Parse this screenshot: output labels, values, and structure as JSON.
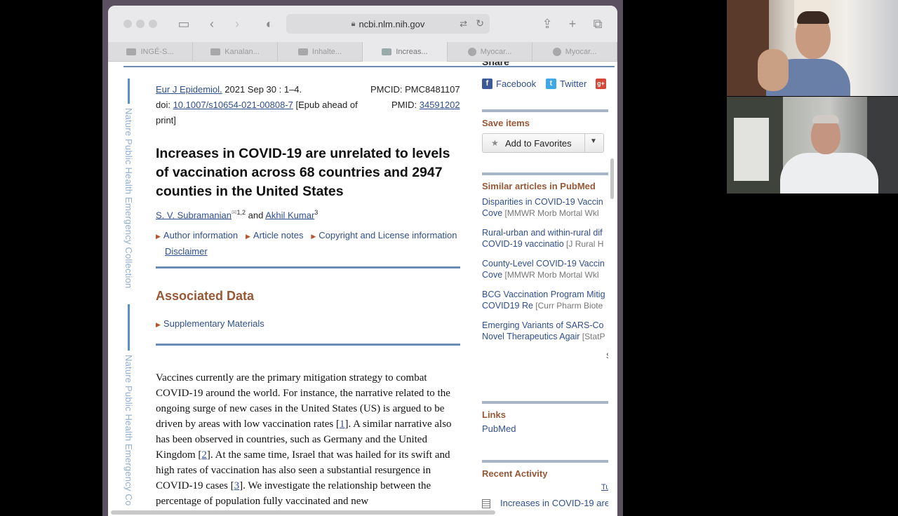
{
  "browser": {
    "url": "ncbi.nlm.nih.gov",
    "tabs": [
      {
        "label": "INGÉ-S..."
      },
      {
        "label": "Kanalan..."
      },
      {
        "label": "Inhalte..."
      },
      {
        "label": "Increas..."
      },
      {
        "label": "Myocar..."
      },
      {
        "label": "Myocar..."
      }
    ],
    "active_tab_index": 3
  },
  "side_rail": {
    "text_1": "Nature Public Health Emergency Collection",
    "text_2": "Nature Public Health Emergency Co"
  },
  "article": {
    "journal": "Eur J Epidemiol.",
    "date": " 2021 Sep 30 : 1–4.",
    "pmcid_label": "PMCID: PMC8481107",
    "doi_label": "doi: ",
    "doi": "10.1007/s10654-021-00808-7",
    "epub_note_1": " [Epub ahead of",
    "epub_note_2": "print]",
    "pmid_label": "PMID: ",
    "pmid": "34591202",
    "title": "Increases in COVID-19 are unrelated to levels of vaccination across 68 countries and 2947 counties in the United States",
    "author_1": "S. V. Subramanian",
    "author_1_sup": "1,2",
    "author_and": " and ",
    "author_2": "Akhil Kumar",
    "author_2_sup": "3",
    "links": {
      "author_info": "Author information",
      "article_notes": "Article notes",
      "copyright": "Copyright and License information",
      "disclaimer": "Disclaimer"
    },
    "associated_data_heading": "Associated Data",
    "supplementary": "Supplementary Materials",
    "body": [
      {
        "t": "Vaccines currently are the primary mitigation strategy to combat COVID-19 around the world. For instance, the narrative related to the ongoing surge of new cases in the United States (US) is argued to be driven by areas with low vaccination rates ["
      },
      {
        "ref": "1"
      },
      {
        "t": "]. A similar narrative also has been observed in countries, such as Germany and the United Kingdom ["
      },
      {
        "ref": "2"
      },
      {
        "t": "]. At the same time, Israel that was hailed for its swift and high rates of vaccination has also seen a substantial resurgence in COVID-19 cases ["
      },
      {
        "ref": "3"
      },
      {
        "t": "]. We investigate the relationship between the percentage of population  fully vaccinated and new"
      }
    ]
  },
  "right_panel": {
    "share_heading": "Share",
    "facebook": "Facebook",
    "twitter": "Twitter",
    "gplus": "g+",
    "save_items": "Save items",
    "add_to_favorites": "Add to Favorites",
    "similar_heading": "Similar articles in PubMed",
    "similar": [
      {
        "line1": "Disparities in COVID-19 Vaccin",
        "line2": "Cove",
        "src": " [MMWR Morb Mortal Wkl"
      },
      {
        "line1": "Rural-urban and within-rural dif",
        "line2": "COVID-19 vaccinatio",
        "src": " [J Rural H"
      },
      {
        "line1": "County-Level COVID-19 Vaccin",
        "line2": "Cove",
        "src": " [MMWR Morb Mortal Wkl"
      },
      {
        "line1": "BCG Vaccination Program Mitig",
        "line2": "COVID19 Re",
        "src": " [Curr Pharm Biote"
      },
      {
        "line1": "Emerging Variants of SARS-Co",
        "line2": "Novel Therapeutics Agair",
        "src": " [StatP"
      }
    ],
    "see_reviews_fragment": "S",
    "links_heading": "Links",
    "pubmed_link": "PubMed",
    "recent_heading": "Recent Activity",
    "turn_off_fragment": "Tu",
    "recent_item": "Increases in COVID-19 are"
  },
  "colors": {
    "link": "#2f4f8f",
    "section_heading": "#985735",
    "rule": "#6b8db3"
  }
}
